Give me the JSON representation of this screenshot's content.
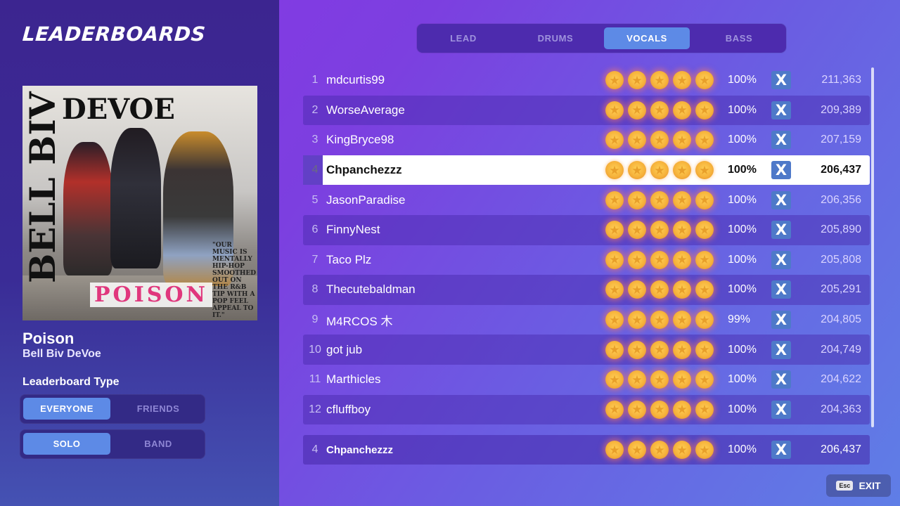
{
  "page_title": "LEADERBOARDS",
  "song": {
    "title": "Poison",
    "artist": "Bell Biv DeVoe",
    "album_art": {
      "band_vertical": "BELL BIV",
      "band_top": "DEVOE",
      "logo": "POISON",
      "quote": "\"OUR MUSIC IS MENTALLY HIP-HOP SMOOTHED OUT ON THE R&B TIP WITH A POP FEEL APPEAL TO IT.\""
    }
  },
  "leaderboard_type_label": "Leaderboard Type",
  "toggles": {
    "scope": {
      "options": [
        "EVERYONE",
        "FRIENDS"
      ],
      "selected": "EVERYONE"
    },
    "mode": {
      "options": [
        "SOLO",
        "BAND"
      ],
      "selected": "SOLO"
    }
  },
  "tabs": [
    {
      "label": "LEAD",
      "active": false
    },
    {
      "label": "DRUMS",
      "active": false
    },
    {
      "label": "VOCALS",
      "active": true
    },
    {
      "label": "BASS",
      "active": false
    }
  ],
  "entries": [
    {
      "rank": "1",
      "name": "mdcurtis99",
      "stars": 5,
      "accuracy": "100%",
      "full_combo": "X",
      "score": "211,363"
    },
    {
      "rank": "2",
      "name": "WorseAverage",
      "stars": 5,
      "accuracy": "100%",
      "full_combo": "X",
      "score": "209,389"
    },
    {
      "rank": "3",
      "name": "KingBryce98",
      "stars": 5,
      "accuracy": "100%",
      "full_combo": "X",
      "score": "207,159"
    },
    {
      "rank": "4",
      "name": "Chpanchezzz",
      "stars": 5,
      "accuracy": "100%",
      "full_combo": "X",
      "score": "206,437",
      "is_player": true
    },
    {
      "rank": "5",
      "name": "JasonParadise",
      "stars": 5,
      "accuracy": "100%",
      "full_combo": "X",
      "score": "206,356"
    },
    {
      "rank": "6",
      "name": "FinnyNest",
      "stars": 5,
      "accuracy": "100%",
      "full_combo": "X",
      "score": "205,890"
    },
    {
      "rank": "7",
      "name": "Taco Plz",
      "stars": 5,
      "accuracy": "100%",
      "full_combo": "X",
      "score": "205,808"
    },
    {
      "rank": "8",
      "name": "Thecutebaldman",
      "stars": 5,
      "accuracy": "100%",
      "full_combo": "X",
      "score": "205,291"
    },
    {
      "rank": "9",
      "name": "M4RCOS ⽊",
      "stars": 5,
      "accuracy": "99%",
      "full_combo": "X",
      "score": "204,805"
    },
    {
      "rank": "10",
      "name": "got jub",
      "stars": 5,
      "accuracy": "100%",
      "full_combo": "X",
      "score": "204,749"
    },
    {
      "rank": "11",
      "name": "Marthicles",
      "stars": 5,
      "accuracy": "100%",
      "full_combo": "X",
      "score": "204,622"
    },
    {
      "rank": "12",
      "name": "cfluffboy",
      "stars": 5,
      "accuracy": "100%",
      "full_combo": "X",
      "score": "204,363"
    }
  ],
  "player_entry": {
    "rank": "4",
    "name": "Chpanchezzz",
    "stars": 5,
    "accuracy": "100%",
    "full_combo": "X",
    "score": "206,437"
  },
  "exit": {
    "key": "Esc",
    "label": "EXIT"
  },
  "colors": {
    "accent_blue": "#5d8ae6",
    "badge_blue": "#4e79c9",
    "star_gold": "#f6b33c",
    "panel_purple": "#3c2590"
  },
  "icons": {
    "star": "star-icon",
    "full_combo": "x-badge-icon",
    "esc": "esc-key-icon"
  }
}
